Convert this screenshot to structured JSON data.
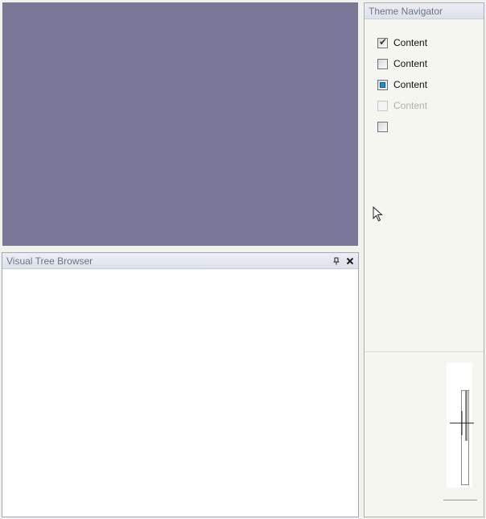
{
  "canvas": {
    "color": "#787797"
  },
  "visual_tree_browser": {
    "title": "Visual Tree Browser",
    "pin_icon": "pin-icon",
    "close_icon": "close-icon"
  },
  "theme_navigator": {
    "title": "Theme Navigator",
    "checkboxes": [
      {
        "label": "Content",
        "state": "checked"
      },
      {
        "label": "Content",
        "state": "unchecked"
      },
      {
        "label": "Content",
        "state": "indeterminate"
      },
      {
        "label": "Content",
        "state": "disabled"
      },
      {
        "label": "",
        "state": "unchecked"
      }
    ]
  },
  "colors": {
    "accent": "#1f8fcf",
    "panel_border": "#9ea7bc"
  }
}
